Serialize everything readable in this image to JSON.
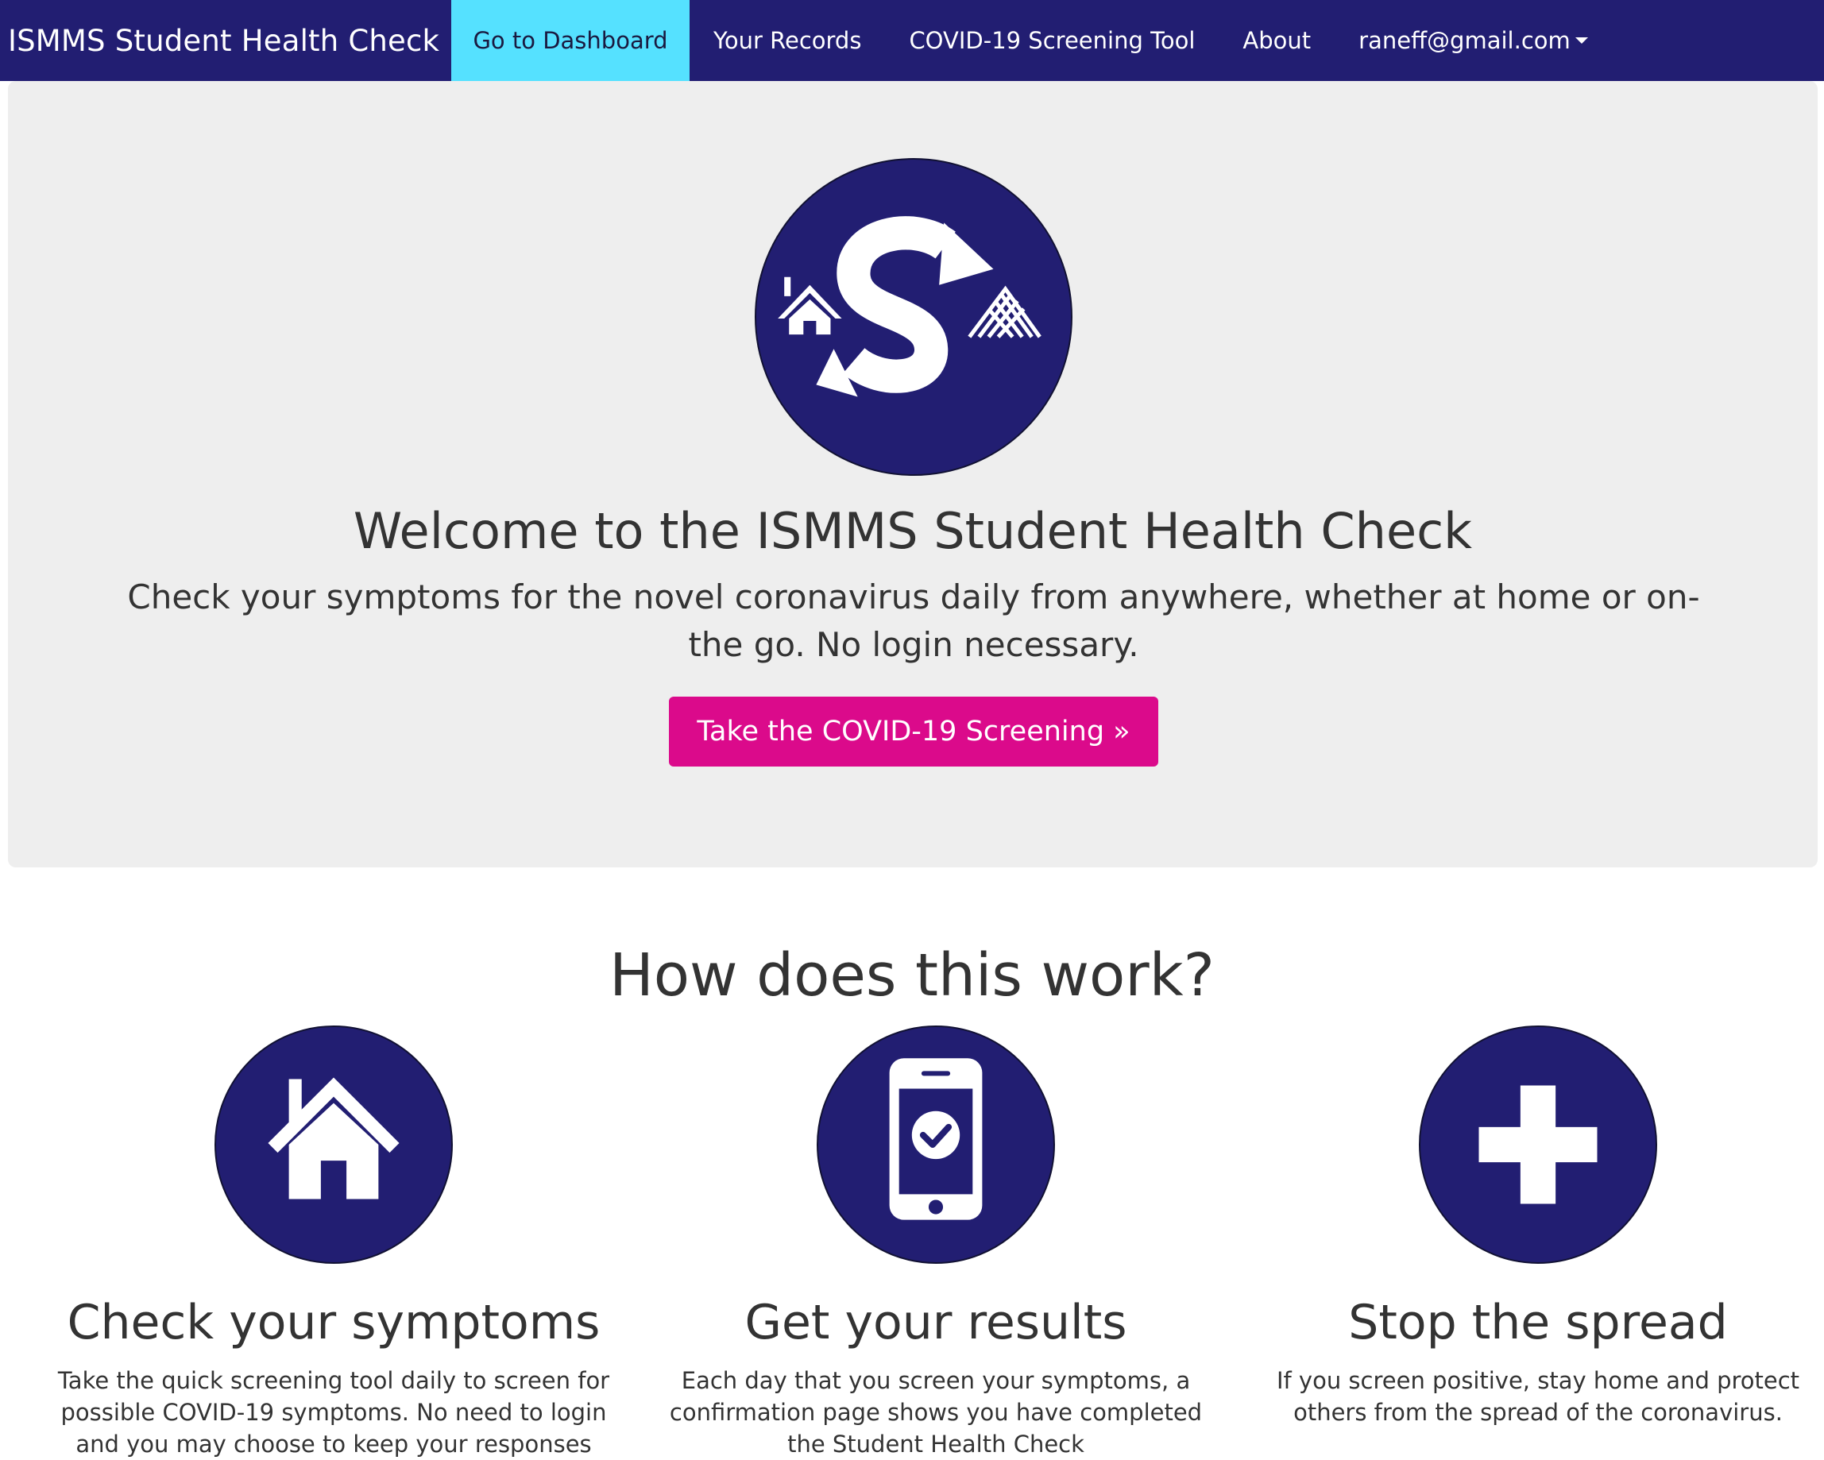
{
  "navbar": {
    "brand": "ISMMS Student Health Check",
    "items": [
      {
        "label": "Go to Dashboard"
      },
      {
        "label": "Your Records"
      },
      {
        "label": "COVID-19 Screening Tool"
      },
      {
        "label": "About"
      },
      {
        "label": "raneff@gmail.com"
      }
    ]
  },
  "hero": {
    "title": "Welcome to the ISMMS Student Health Check",
    "lead": "Check your symptoms for the novel coronavirus daily from anywhere, whether at home or on-the go. No login necessary.",
    "cta_label": "Take the COVID-19 Screening »"
  },
  "how": {
    "title": "How does this work?",
    "features": [
      {
        "icon": "house-icon",
        "title": "Check your symptoms",
        "text": "Take the quick screening tool daily to screen for possible COVID-19 symptoms. No need to login and you may choose to keep your responses"
      },
      {
        "icon": "phone-check-icon",
        "title": "Get your results",
        "text": "Each day that you screen your symptoms, a confirmation page shows you have completed the Student Health Check"
      },
      {
        "icon": "plus-icon",
        "title": "Stop the spread",
        "text": "If you screen positive, stay home and protect others from the spread of the coronavirus."
      }
    ]
  },
  "colors": {
    "navbar_bg": "#221e72",
    "active_tab": "#55e1ff",
    "cta": "#db0a8b",
    "icon_circle": "#221e72",
    "jumbotron_bg": "#eeeeee"
  }
}
